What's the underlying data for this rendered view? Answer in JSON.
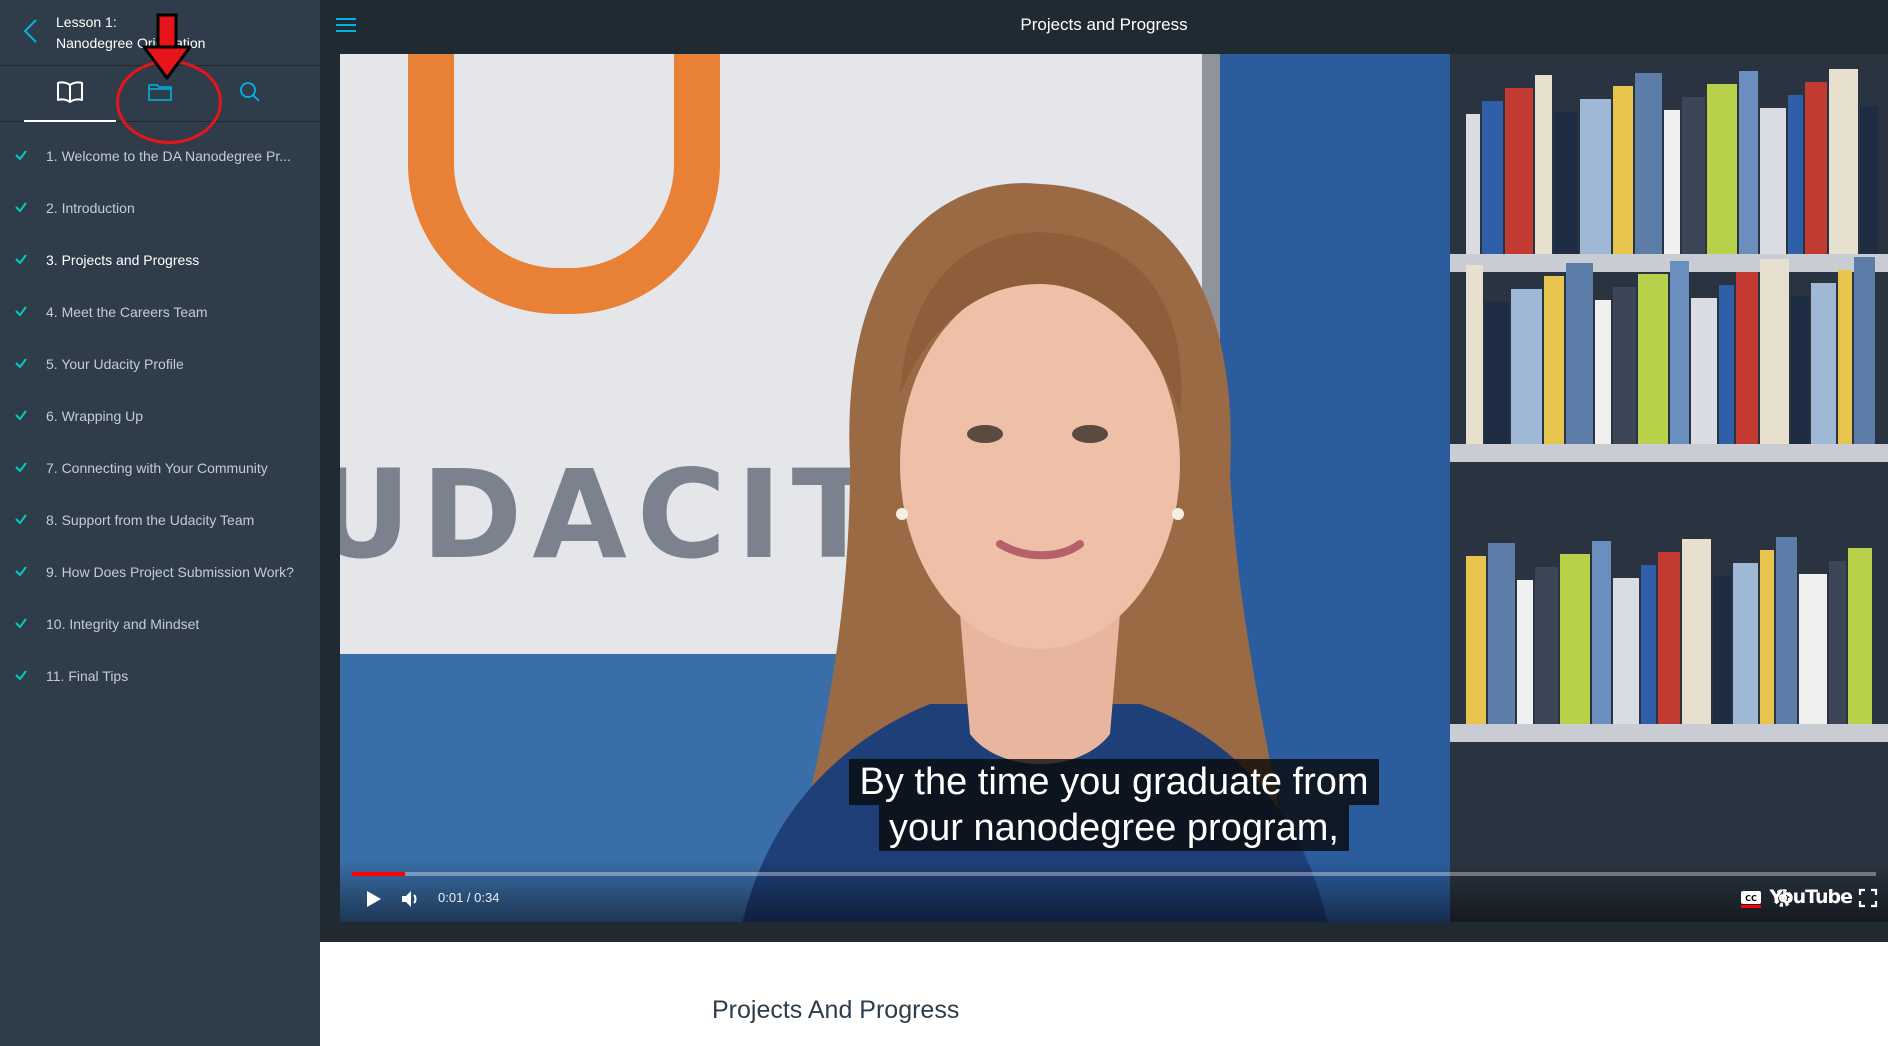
{
  "sidebar": {
    "lesson_line1": "Lesson 1:",
    "lesson_line2": "Nanodegree Orientation",
    "tabs": [
      {
        "name": "book-icon",
        "active": true
      },
      {
        "name": "folder-icon",
        "active": false
      },
      {
        "name": "search-icon",
        "active": false
      }
    ],
    "items": [
      {
        "label": "1. Welcome to the DA Nanodegree Pr...",
        "completed": true
      },
      {
        "label": "2. Introduction",
        "completed": true
      },
      {
        "label": "3. Projects and Progress",
        "completed": true,
        "current": true
      },
      {
        "label": "4. Meet the Careers Team",
        "completed": true
      },
      {
        "label": "5. Your Udacity Profile",
        "completed": true
      },
      {
        "label": "6. Wrapping Up",
        "completed": true
      },
      {
        "label": "7. Connecting with Your Community",
        "completed": true
      },
      {
        "label": "8. Support from the Udacity Team",
        "completed": true
      },
      {
        "label": "9. How Does Project Submission Work?",
        "completed": true
      },
      {
        "label": "10. Integrity and Mindset",
        "completed": true
      },
      {
        "label": "11. Final Tips",
        "completed": true
      }
    ]
  },
  "header": {
    "title": "Projects and Progress"
  },
  "video": {
    "board_text": "UDACITY",
    "subtitle_line1": "By the time you graduate from",
    "subtitle_line2": "your nanodegree program,",
    "time": "0:01 / 0:34",
    "progress_fraction": 0.035,
    "youtube_label": "YouTube"
  },
  "content": {
    "title": "Projects And Progress"
  },
  "colors": {
    "sidebar_bg": "#2e3d49",
    "accent": "#02b3e4",
    "annotation": "#e8141c"
  }
}
